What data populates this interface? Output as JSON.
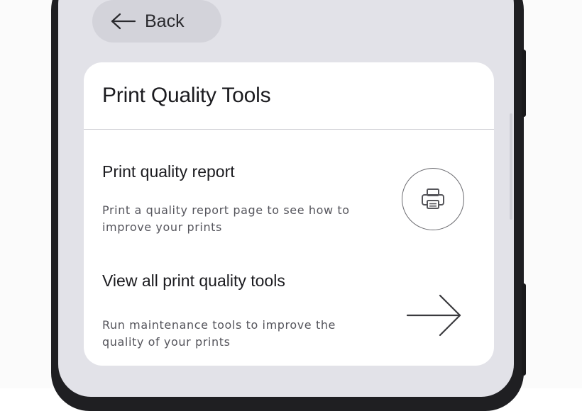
{
  "nav": {
    "back_label": "Back",
    "back_icon": "arrow-left-icon"
  },
  "card": {
    "title": "Print Quality Tools",
    "items": [
      {
        "title": "Print quality report",
        "description": "Print a quality report page to see how to improve your prints",
        "icon": "printer-icon"
      },
      {
        "title": "View all print quality tools",
        "description": "Run maintenance tools to improve the quality of your prints",
        "icon": "arrow-right-icon"
      }
    ]
  },
  "colors": {
    "screen_background": "#e2e2e8",
    "card_background": "#ffffff",
    "back_pill": "#d3d3da",
    "phone_frame": "#1f1f22"
  }
}
